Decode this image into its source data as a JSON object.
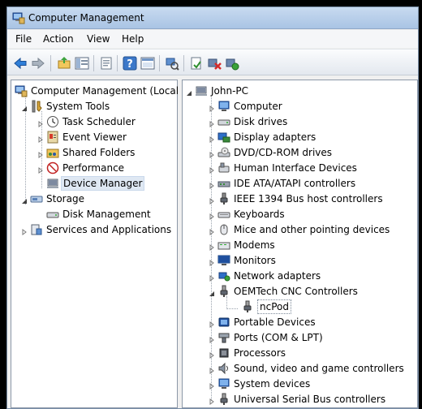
{
  "window": {
    "title": "Computer Management"
  },
  "menu": [
    {
      "label": "File"
    },
    {
      "label": "Action"
    },
    {
      "label": "View"
    },
    {
      "label": "Help"
    }
  ],
  "left_tree": {
    "root": "Computer Management (Local",
    "system_tools": "System Tools",
    "task_scheduler": "Task Scheduler",
    "event_viewer": "Event Viewer",
    "shared_folders": "Shared Folders",
    "performance": "Performance",
    "device_manager": "Device Manager",
    "storage": "Storage",
    "disk_management": "Disk Management",
    "services": "Services and Applications"
  },
  "right_tree": {
    "root": "John-PC",
    "items": [
      {
        "label": "Computer",
        "icon": "computer-icon"
      },
      {
        "label": "Disk drives",
        "icon": "disk-drive-icon"
      },
      {
        "label": "Display adapters",
        "icon": "display-adapter-icon"
      },
      {
        "label": "DVD/CD-ROM drives",
        "icon": "dvd-drive-icon"
      },
      {
        "label": "Human Interface Devices",
        "icon": "hid-icon"
      },
      {
        "label": "IDE ATA/ATAPI controllers",
        "icon": "ide-controller-icon"
      },
      {
        "label": "IEEE 1394 Bus host controllers",
        "icon": "ieee1394-icon"
      },
      {
        "label": "Keyboards",
        "icon": "keyboard-icon"
      },
      {
        "label": "Mice and other pointing devices",
        "icon": "mouse-icon"
      },
      {
        "label": "Modems",
        "icon": "modem-icon"
      },
      {
        "label": "Monitors",
        "icon": "monitor-icon"
      },
      {
        "label": "Network adapters",
        "icon": "network-adapter-icon"
      },
      {
        "label": "OEMTech CNC Controllers",
        "icon": "usb-plug-icon"
      },
      {
        "label": "ncPod",
        "icon": "usb-plug-icon"
      },
      {
        "label": "Portable Devices",
        "icon": "portable-device-icon"
      },
      {
        "label": "Ports (COM & LPT)",
        "icon": "port-icon"
      },
      {
        "label": "Processors",
        "icon": "processor-icon"
      },
      {
        "label": "Sound, video and game controllers",
        "icon": "sound-icon"
      },
      {
        "label": "System devices",
        "icon": "system-device-icon"
      },
      {
        "label": "Universal Serial Bus controllers",
        "icon": "usb-plug-icon"
      }
    ]
  },
  "colors": {
    "selection": "#dfe8f3",
    "titlebar": "#b8d0ec",
    "pane_border": "#8c98a8"
  }
}
